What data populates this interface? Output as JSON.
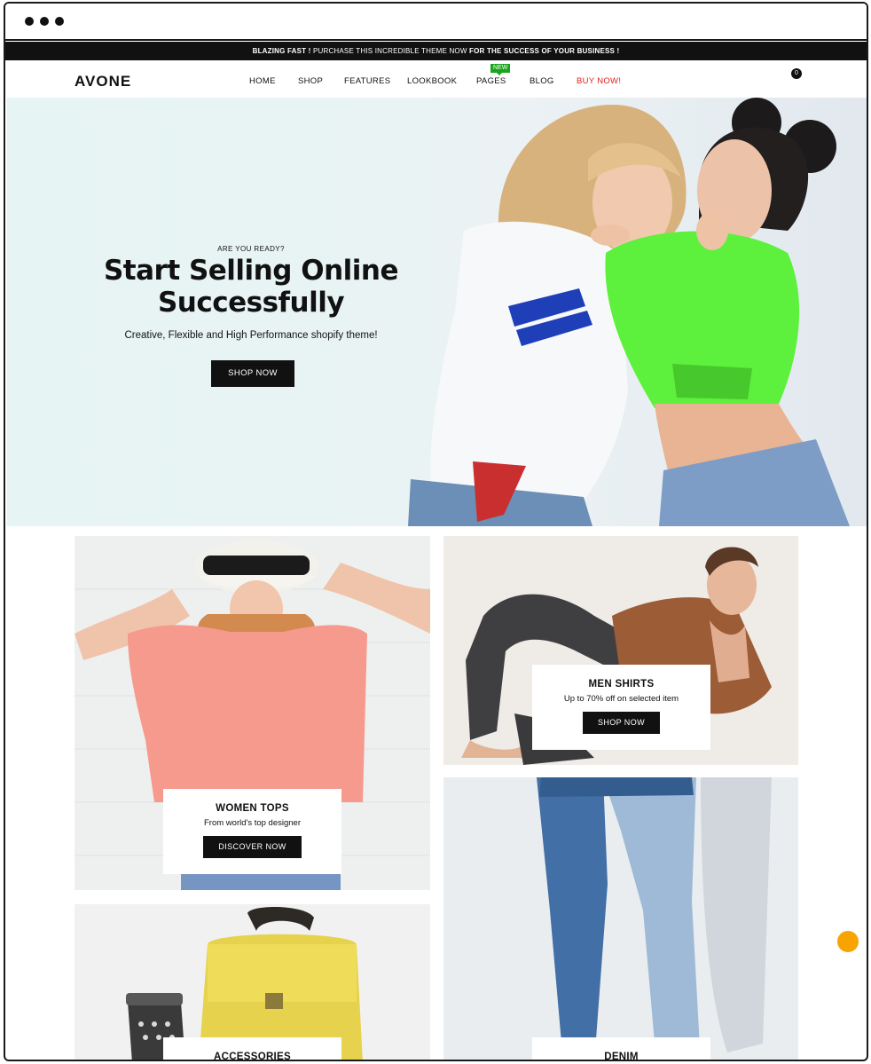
{
  "announcement": {
    "lead": "BLAZING FAST !",
    "middle": "PURCHASE THIS INCREDIBLE THEME NOW",
    "tail": "FOR THE SUCCESS OF YOUR BUSINESS !"
  },
  "header": {
    "logo": "AVONE",
    "menu": [
      {
        "label": "HOME"
      },
      {
        "label": "SHOP"
      },
      {
        "label": "FEATURES"
      },
      {
        "label": "LOOKBOOK"
      },
      {
        "label": "PAGES",
        "badge": "NEW"
      },
      {
        "label": "BLOG"
      },
      {
        "label": "BUY NOW!"
      }
    ],
    "cart_count": "0"
  },
  "hero": {
    "pretitle": "ARE YOU READY?",
    "title_line1": "Start Selling Online",
    "title_line2": "Successfully",
    "subtitle": "Creative, Flexible and High Performance shopify theme!",
    "button": "SHOP NOW"
  },
  "collections": {
    "women": {
      "title": "WOMEN TOPS",
      "subtitle": "From world's top designer",
      "button": "DISCOVER NOW"
    },
    "men": {
      "title": "MEN SHIRTS",
      "subtitle": "Up to 70% off on selected item",
      "button": "SHOP NOW"
    },
    "accessories": {
      "title": "ACCESSORIES"
    },
    "denim": {
      "title": "DENIM"
    }
  },
  "colors": {
    "accent_buy": "#e0201d",
    "badge_new": "#19a51d",
    "fab": "#f7a400",
    "hero_bg": "#e6f4f3"
  }
}
